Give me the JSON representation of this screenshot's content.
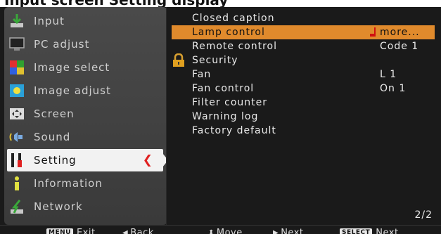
{
  "top_text": "Input screen Setting display",
  "menu": {
    "items": [
      {
        "label": "Input",
        "icon": "input-icon",
        "active": false
      },
      {
        "label": "PC adjust",
        "icon": "monitor-icon",
        "active": false
      },
      {
        "label": "Image select",
        "icon": "image-select-icon",
        "active": false
      },
      {
        "label": "Image adjust",
        "icon": "image-adjust-icon",
        "active": false
      },
      {
        "label": "Screen",
        "icon": "screen-icon",
        "active": false
      },
      {
        "label": "Sound",
        "icon": "speaker-icon",
        "active": false
      },
      {
        "label": "Setting",
        "icon": "setting-icon",
        "active": true
      },
      {
        "label": "Information",
        "icon": "information-icon",
        "active": false
      },
      {
        "label": "Network",
        "icon": "network-icon",
        "active": false
      }
    ],
    "selected_marker": "❮"
  },
  "panel": {
    "rows": [
      {
        "label": "Closed caption",
        "value": ""
      },
      {
        "label": "Lamp control",
        "value": "more...",
        "highlight": true
      },
      {
        "label": "Remote control",
        "value": "Code 1"
      },
      {
        "label": "Security",
        "value": ""
      },
      {
        "label": "Fan",
        "value": "L 1"
      },
      {
        "label": "Fan control",
        "value": "On 1"
      },
      {
        "label": "Filter counter",
        "value": ""
      },
      {
        "label": "Warning log",
        "value": ""
      },
      {
        "label": "Factory default",
        "value": ""
      }
    ],
    "page": "2/2"
  },
  "footer": {
    "menu_key": "MENU",
    "exit": "Exit",
    "back": "Back",
    "move": "Move",
    "next": "Next",
    "select_key": "SELECT",
    "select_next": "Next"
  },
  "colors": {
    "highlight": "#e08a2c",
    "panel_bg": "#1a1a1a",
    "menu_bg": "#444444",
    "active_arrow": "#e02020"
  }
}
